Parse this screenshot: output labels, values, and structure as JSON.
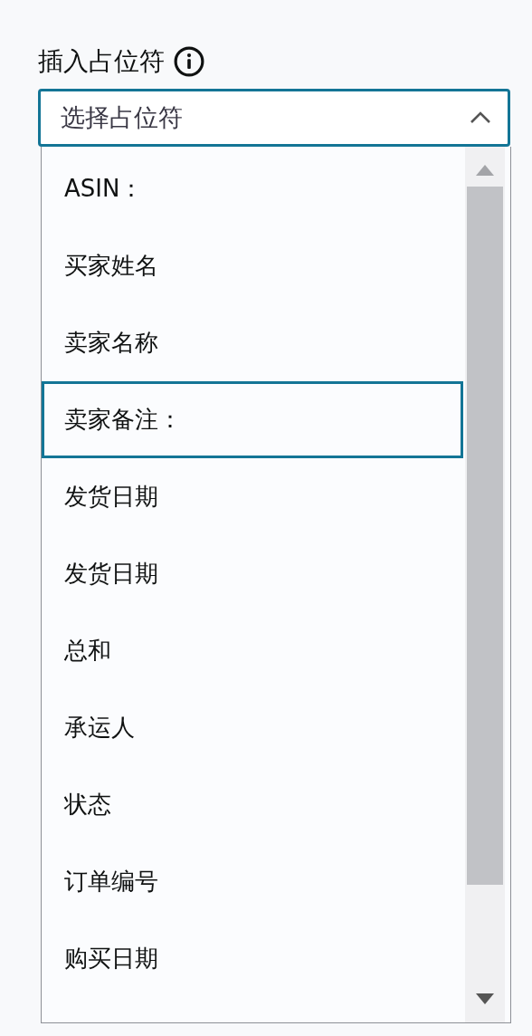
{
  "label": "插入占位符",
  "select": {
    "placeholder": "选择占位符",
    "expanded": true
  },
  "options": [
    {
      "label": "ASIN：",
      "selected": false
    },
    {
      "label": "买家姓名",
      "selected": false
    },
    {
      "label": "卖家名称",
      "selected": false
    },
    {
      "label": "卖家备注：",
      "selected": true
    },
    {
      "label": "发货日期",
      "selected": false
    },
    {
      "label": "发货日期",
      "selected": false
    },
    {
      "label": "总和",
      "selected": false
    },
    {
      "label": "承运人",
      "selected": false
    },
    {
      "label": "状态",
      "selected": false
    },
    {
      "label": "订单编号",
      "selected": false
    },
    {
      "label": "购买日期",
      "selected": false
    }
  ]
}
